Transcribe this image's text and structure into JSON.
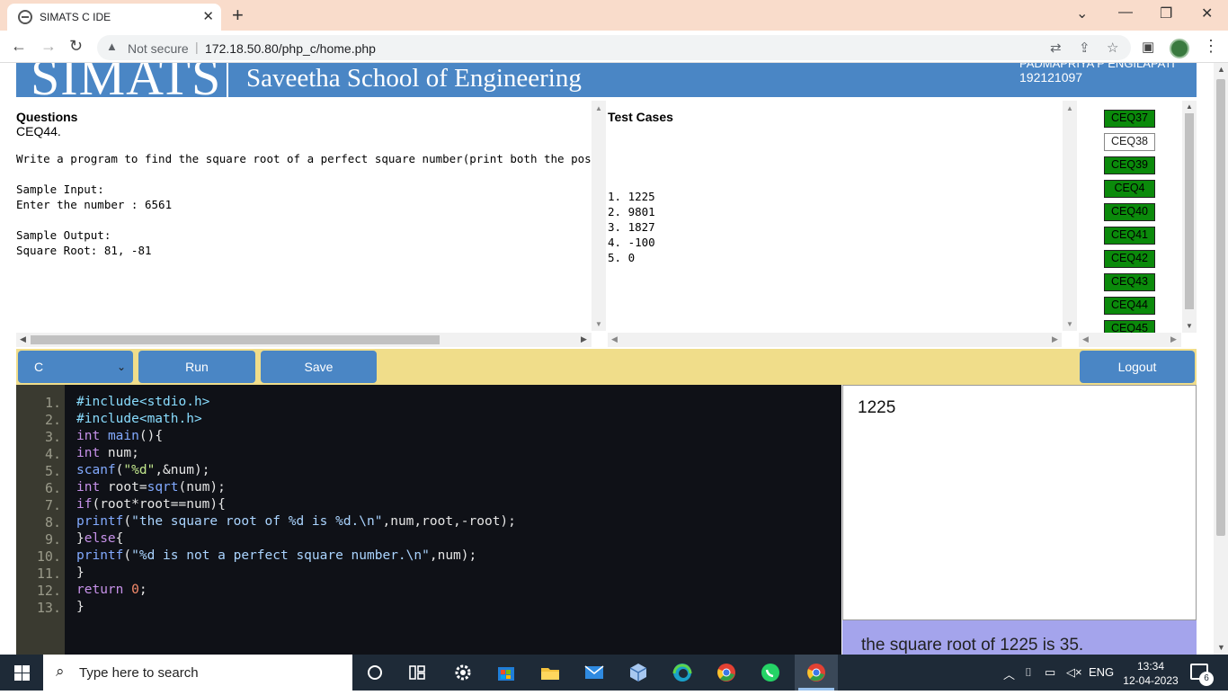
{
  "browser": {
    "tab_title": "SIMATS C IDE",
    "tab_close": "✕",
    "new_tab": "+",
    "security_label": "Not secure",
    "url": "172.18.50.80/php_c/home.php"
  },
  "banner": {
    "logo_text": "SIMATS",
    "school_name": "Saveetha School of Engineering",
    "user_name": "PADMAPRIYA P ENGILAPATI",
    "user_id": "192121097"
  },
  "questions": {
    "heading": "Questions",
    "code": "CEQ44.",
    "text": "Write a program to find the square root of a perfect square number(print both the positive and negative roots).\n\nSample Input:\nEnter the number : 6561\n\nSample Output:\nSquare Root: 81, -81"
  },
  "test_cases": {
    "heading": "Test Cases",
    "items": [
      "1. 1225",
      "2. 9801",
      "3. 1827",
      "4. -100",
      "5. 0"
    ]
  },
  "question_list": [
    {
      "label": "CEQ37",
      "status": "done"
    },
    {
      "label": "CEQ38",
      "status": "current"
    },
    {
      "label": "CEQ39",
      "status": "done"
    },
    {
      "label": "CEQ4",
      "status": "done"
    },
    {
      "label": "CEQ40",
      "status": "done"
    },
    {
      "label": "CEQ41",
      "status": "done"
    },
    {
      "label": "CEQ42",
      "status": "done"
    },
    {
      "label": "CEQ43",
      "status": "done"
    },
    {
      "label": "CEQ44",
      "status": "done"
    },
    {
      "label": "CEQ45",
      "status": "done"
    }
  ],
  "toolbar": {
    "language": "C",
    "run_label": "Run",
    "save_label": "Save",
    "logout_label": "Logout"
  },
  "editor": {
    "line_numbers": [
      "1.",
      "2.",
      "3.",
      "4.",
      "5.",
      "6.",
      "7.",
      "8.",
      "9.",
      "10.",
      "11.",
      "12.",
      "13."
    ]
  },
  "io": {
    "input_value": "1225",
    "output_value": "the square root of 1225 is 35."
  },
  "taskbar": {
    "search_placeholder": "Type here to search",
    "language": "ENG",
    "time": "13:34",
    "date": "12-04-2023",
    "notification_count": "6"
  },
  "colors": {
    "banner": "#4a86c5",
    "toolbar": "#f0dd8a",
    "done_question": "#0b8a0b",
    "editor_bg": "#0f1117",
    "output_bg": "#a4a4ec"
  }
}
